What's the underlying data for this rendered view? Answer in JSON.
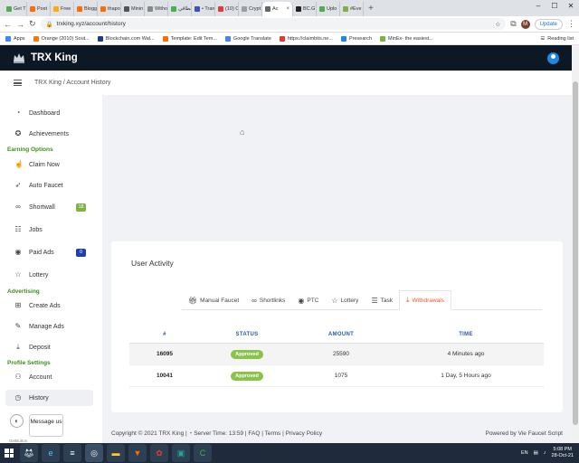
{
  "browser": {
    "tabs": [
      {
        "label": "Get T",
        "color": "#4caf50"
      },
      {
        "label": "Post",
        "color": "#ff6d00"
      },
      {
        "label": "Free",
        "color": "#ffab00"
      },
      {
        "label": "Blogg",
        "color": "#ff6d00"
      },
      {
        "label": "thapo",
        "color": "#ff6d00"
      },
      {
        "label": "Minin",
        "color": "#555555"
      },
      {
        "label": "Witho",
        "color": "#888888"
      },
      {
        "label": "بطاقي",
        "color": "#4caf50"
      },
      {
        "label": "• Tran",
        "color": "#3f51b5"
      },
      {
        "label": "(10) C",
        "color": "#e53935"
      },
      {
        "label": "Crypt",
        "color": "#9e9e9e"
      },
      {
        "label": "Ac",
        "color": "#666666",
        "active": true
      },
      {
        "label": "BC.G",
        "color": "#212121"
      },
      {
        "label": "Uplo",
        "color": "#4caf50"
      },
      {
        "label": "#Eve",
        "color": "#7cb342"
      }
    ],
    "url": "trxking.xyz/account/history",
    "update_label": "Update",
    "profile_initial": "M",
    "bookmarks": [
      {
        "label": "Apps",
        "color": "#4285f4"
      },
      {
        "label": "Orange (2010) Sout...",
        "color": "#ff7900"
      },
      {
        "label": "Blockchain.com Wal...",
        "color": "#1e3a8a"
      },
      {
        "label": "Template: Edit Tem...",
        "color": "#ff6d00"
      },
      {
        "label": "Google Translate",
        "color": "#4285f4"
      },
      {
        "label": "https://claimbits.ne...",
        "color": "#e53935"
      },
      {
        "label": "Presearch",
        "color": "#1e88e5"
      },
      {
        "label": "MinEx- the easiest...",
        "color": "#7cb342"
      }
    ],
    "reading_list": "Reading list"
  },
  "site": {
    "brand": "TRX King",
    "breadcrumb": "TRX King / Account History"
  },
  "sidebar": {
    "items": [
      {
        "label": "Dashboard",
        "icon": "gauge-icon"
      },
      {
        "label": "Achievements",
        "icon": "medal-icon"
      },
      {
        "label": "Claim Now",
        "icon": "hand-icon"
      },
      {
        "label": "Auto Faucet",
        "icon": "rocket-icon"
      },
      {
        "label": "Shortwall",
        "icon": "link-icon",
        "badge": "18",
        "badge_color": "#7cb342"
      },
      {
        "label": "Jobs",
        "icon": "jobs-icon"
      },
      {
        "label": "Paid Ads",
        "icon": "eye-icon",
        "badge": "0",
        "badge_color": "#1e40af"
      },
      {
        "label": "Lottery",
        "icon": "star-icon"
      },
      {
        "label": "Create Ads",
        "icon": "plus-square-icon"
      },
      {
        "label": "Manage Ads",
        "icon": "chat-icon"
      },
      {
        "label": "Deposit",
        "icon": "download-icon"
      },
      {
        "label": "Account",
        "icon": "user-icon"
      },
      {
        "label": "History",
        "icon": "clock-icon"
      }
    ],
    "sections": [
      "Earning Options",
      "Advertising",
      "Profile Settings"
    ]
  },
  "activity": {
    "title": "User Activity",
    "tabs": [
      {
        "label": "Manual Faucet",
        "icon": "gift-icon"
      },
      {
        "label": "Shortlinks",
        "icon": "link-icon"
      },
      {
        "label": "PTC",
        "icon": "eye-icon"
      },
      {
        "label": "Lottery",
        "icon": "star-icon"
      },
      {
        "label": "Task",
        "icon": "list-icon"
      },
      {
        "label": "Withdrawals",
        "icon": "download-icon",
        "active": true
      }
    ],
    "columns": [
      "#",
      "STATUS",
      "AMOUNT",
      "TIME"
    ],
    "rows": [
      {
        "id": "16095",
        "status": "Approved",
        "amount": "25590",
        "time": "4 Minutes ago"
      },
      {
        "id": "10041",
        "status": "Approved",
        "amount": "1075",
        "time": "1 Day, 5 Hours ago"
      }
    ]
  },
  "footer": {
    "left": "Copyright © 2021 TRX King | ◔ Server Time: 13:59 | FAQ | Terms | Privacy Policy",
    "right": "Powered by Vie Faucet Script"
  },
  "chat": {
    "message_label": "Message us",
    "getbutton": "GetButton"
  },
  "taskbar": {
    "lang": "EN",
    "time": "5:08 PM",
    "date": "28-Oct-21"
  }
}
